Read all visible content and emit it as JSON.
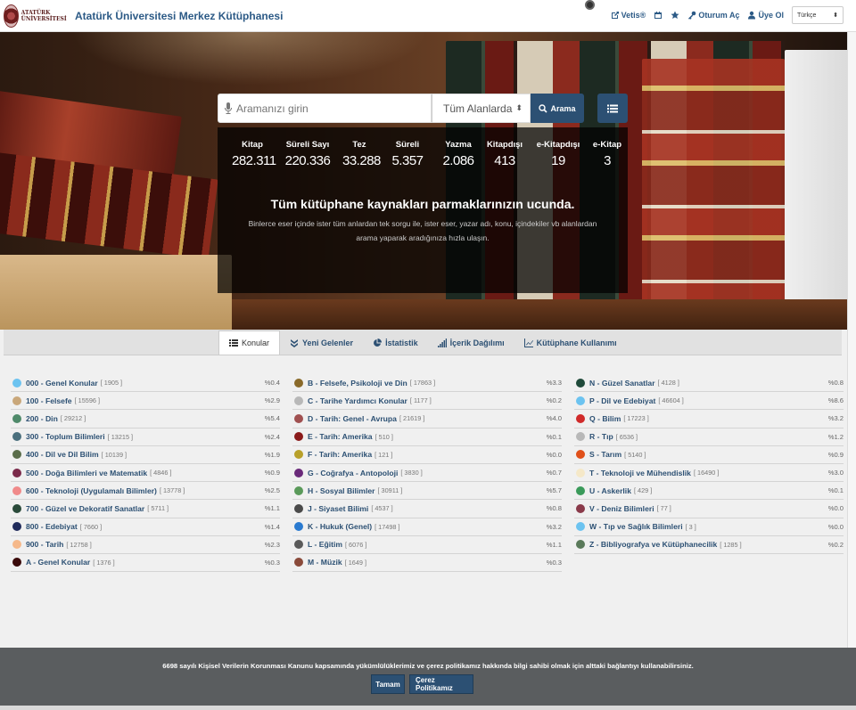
{
  "header": {
    "logo_text": "ATATÜRK ÜNİVERSİTESİ",
    "site_title": "Atatürk Üniversitesi Merkez Kütüphanesi",
    "nav": {
      "vetis": "Vetis®",
      "login": "Oturum Aç",
      "register": "Üye Ol"
    },
    "language": "Türkçe"
  },
  "search": {
    "placeholder": "Aramanızı girin",
    "scope": "Tüm Alanlarda",
    "button_label": "Arama"
  },
  "stats": [
    {
      "label": "Kitap",
      "value": "282.311"
    },
    {
      "label": "Süreli Sayı",
      "value": "220.336"
    },
    {
      "label": "Tez",
      "value": "33.288"
    },
    {
      "label": "Süreli",
      "value": "5.357"
    },
    {
      "label": "Yazma",
      "value": "2.086"
    },
    {
      "label": "Kitapdışı",
      "value": "413"
    },
    {
      "label": "e-Kitapdışı",
      "value": "19"
    },
    {
      "label": "e-Kitap",
      "value": "3"
    }
  ],
  "hero": {
    "tagline": "Tüm kütüphane kaynakları parmaklarınızın ucunda.",
    "description": "Binlerce eser içinde ister tüm anlardan tek sorgu ile, ister eser, yazar adı, konu, içindekiler vb alanlardan arama yaparak aradığınıza hızla ulaşın."
  },
  "tabs": [
    {
      "label": "Konular",
      "icon": "list-icon",
      "active": true
    },
    {
      "label": "Yeni Gelenler",
      "icon": "double-chevron-down-icon",
      "active": false
    },
    {
      "label": "İstatistik",
      "icon": "pie-chart-icon",
      "active": false
    },
    {
      "label": "İçerik Dağılımı",
      "icon": "signal-bars-icon",
      "active": false
    },
    {
      "label": "Kütüphane Kullanımı",
      "icon": "line-chart-icon",
      "active": false
    }
  ],
  "subjects": [
    [
      {
        "name": "000 - Genel Konular",
        "count": "[ 1905 ]",
        "pct": "%0.4",
        "color": "#6cc3f0"
      },
      {
        "name": "100 - Felsefe",
        "count": "[ 15596 ]",
        "pct": "%2.9",
        "color": "#c9a77a"
      },
      {
        "name": "200 - Din",
        "count": "[ 29212 ]",
        "pct": "%5.4",
        "color": "#4f8a6a"
      },
      {
        "name": "300 - Toplum Bilimleri",
        "count": "[ 13215 ]",
        "pct": "%2.4",
        "color": "#4a6f7d"
      },
      {
        "name": "400 - Dil ve Dil Bilim",
        "count": "[ 10139 ]",
        "pct": "%1.9",
        "color": "#5a6d4a"
      },
      {
        "name": "500 - Doğa Bilimleri ve Matematik",
        "count": "[ 4846 ]",
        "pct": "%0.9",
        "color": "#7a2a4a"
      },
      {
        "name": "600 - Teknoloji (Uygulamalı Bilimler)",
        "count": "[ 13778 ]",
        "pct": "%2.5",
        "color": "#f08a8a"
      },
      {
        "name": "700 - Güzel ve Dekoratif Sanatlar",
        "count": "[ 5711 ]",
        "pct": "%1.1",
        "color": "#2a4a3a"
      },
      {
        "name": "800 - Edebiyat",
        "count": "[ 7660 ]",
        "pct": "%1.4",
        "color": "#1f2a5a"
      },
      {
        "name": "900 - Tarih",
        "count": "[ 12758 ]",
        "pct": "%2.3",
        "color": "#f5b88a"
      },
      {
        "name": "A - Genel Konular",
        "count": "[ 1376 ]",
        "pct": "%0.3",
        "color": "#3a0a0a"
      }
    ],
    [
      {
        "name": "B - Felsefe, Psikoloji ve Din",
        "count": "[ 17863 ]",
        "pct": "%3.3",
        "color": "#8a6a2a"
      },
      {
        "name": "C - Tarihe Yardımcı Konular",
        "count": "[ 1177 ]",
        "pct": "%0.2",
        "color": "#b8b8b8"
      },
      {
        "name": "D - Tarih: Genel - Avrupa",
        "count": "[ 21619 ]",
        "pct": "%4.0",
        "color": "#a05050"
      },
      {
        "name": "E - Tarih: Amerika",
        "count": "[ 510 ]",
        "pct": "%0.1",
        "color": "#8a1a1a"
      },
      {
        "name": "F - Tarih: Amerika",
        "count": "[ 121 ]",
        "pct": "%0.0",
        "color": "#b8a02a"
      },
      {
        "name": "G - Coğrafya - Antopoloji",
        "count": "[ 3830 ]",
        "pct": "%0.7",
        "color": "#6a2a7a"
      },
      {
        "name": "H - Sosyal Bilimler",
        "count": "[ 30911 ]",
        "pct": "%5.7",
        "color": "#5a9a5a"
      },
      {
        "name": "J - Siyaset Bilimi",
        "count": "[ 4537 ]",
        "pct": "%0.8",
        "color": "#4a4a4a"
      },
      {
        "name": "K - Hukuk (Genel)",
        "count": "[ 17498 ]",
        "pct": "%3.2",
        "color": "#2a7ad0"
      },
      {
        "name": "L - Eğitim",
        "count": "[ 6076 ]",
        "pct": "%1.1",
        "color": "#5a5a5a"
      },
      {
        "name": "M - Müzik",
        "count": "[ 1649 ]",
        "pct": "%0.3",
        "color": "#8a4a3a"
      }
    ],
    [
      {
        "name": "N - Güzel Sanatlar",
        "count": "[ 4128 ]",
        "pct": "%0.8",
        "color": "#1f4a3a"
      },
      {
        "name": "P - Dil ve Edebiyat",
        "count": "[ 46604 ]",
        "pct": "%8.6",
        "color": "#6cc3f0"
      },
      {
        "name": "Q - Bilim",
        "count": "[ 17223 ]",
        "pct": "%3.2",
        "color": "#d02a2a"
      },
      {
        "name": "R - Tıp",
        "count": "[ 6536 ]",
        "pct": "%1.2",
        "color": "#b8b8b8"
      },
      {
        "name": "S - Tarım",
        "count": "[ 5140 ]",
        "pct": "%0.9",
        "color": "#e0501a"
      },
      {
        "name": "T - Teknoloji ve Mühendislik",
        "count": "[ 16490 ]",
        "pct": "%3.0",
        "color": "#f5e8c8"
      },
      {
        "name": "U - Askerlik",
        "count": "[ 429 ]",
        "pct": "%0.1",
        "color": "#3a9a5a"
      },
      {
        "name": "V - Deniz Bilimleri",
        "count": "[ 77 ]",
        "pct": "%0.0",
        "color": "#8a3a4a"
      },
      {
        "name": "W - Tıp ve Sağlık Bilimleri",
        "count": "[ 3 ]",
        "pct": "%0.0",
        "color": "#6cc3f0"
      },
      {
        "name": "Z - Bibliyografya ve Kütüphanecilik",
        "count": "[ 1285 ]",
        "pct": "%0.2",
        "color": "#5a7a5a"
      }
    ]
  ],
  "cookie": {
    "text": "6698 sayılı Kişisel Verilerin Korunması Kanunu kapsamında yükümlülüklerimiz ve çerez politikamız hakkında bilgi sahibi olmak için alttaki bağlantıyı kullanabilirsiniz.",
    "accept_label": "Tamam",
    "policy_label": "Çerez Politikamız"
  }
}
